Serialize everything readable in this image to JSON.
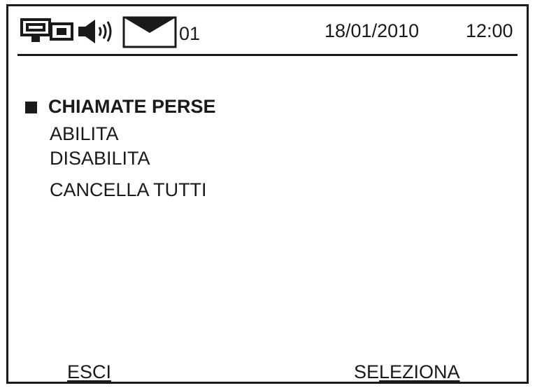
{
  "status_bar": {
    "icons": [
      "phone-icon",
      "speaker-icon",
      "envelope-icon"
    ],
    "message_count": "01",
    "date": "18/01/2010",
    "time": "12:00"
  },
  "menu": {
    "title": "CHIAMATE PERSE",
    "items": [
      "ABILITA",
      "DISABILITA",
      "CANCELLA TUTTI"
    ]
  },
  "softkeys": {
    "left": "ESCI",
    "right_prefix": "SE",
    "right_underlined": "LEZIONA"
  },
  "colors": {
    "ink": "#1a1a1a",
    "background": "#ffffff"
  }
}
